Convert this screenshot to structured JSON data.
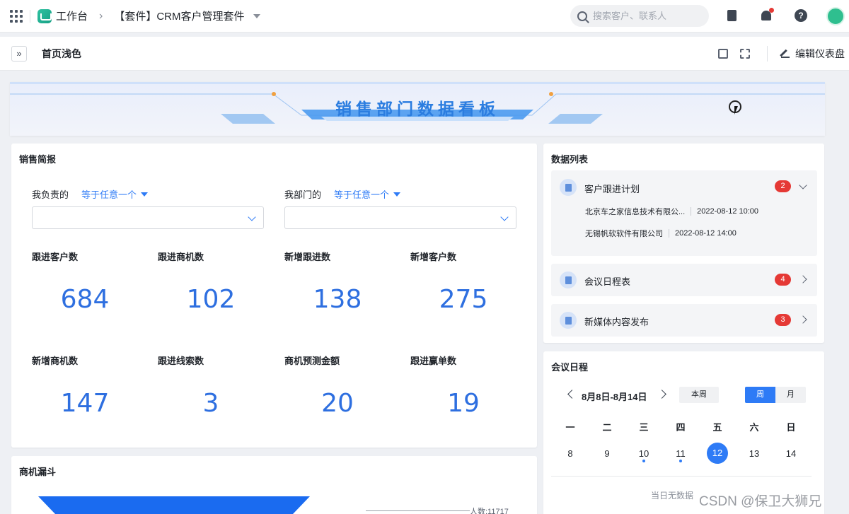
{
  "topbar": {
    "app_name": "工作台",
    "crumb_sep": "›",
    "suite_name": "【套件】CRM客户管理套件",
    "search_placeholder": "搜索客户、联系人",
    "help_label": "?"
  },
  "subbar": {
    "page_tab": "首页浅色",
    "expand_label": "»",
    "edit_label": "编辑仪表盘"
  },
  "banner": {
    "title": "销售部门数据看板"
  },
  "sales_brief": {
    "title": "销售简报",
    "filters": [
      {
        "label": "我负责的",
        "operator": "等于任意一个",
        "value": ""
      },
      {
        "label": "我部门的",
        "operator": "等于任意一个",
        "value": ""
      }
    ],
    "metrics": [
      {
        "label": "跟进客户数",
        "value": "684"
      },
      {
        "label": "跟进商机数",
        "value": "102"
      },
      {
        "label": "新增跟进数",
        "value": "138"
      },
      {
        "label": "新增客户数",
        "value": "275"
      },
      {
        "label": "新增商机数",
        "value": "147"
      },
      {
        "label": "跟进线索数",
        "value": "3"
      },
      {
        "label": "商机预测金额",
        "value": "20"
      },
      {
        "label": "跟进赢单数",
        "value": "19"
      }
    ]
  },
  "funnel": {
    "title": "商机漏斗",
    "label": "人数:11717",
    "color": "#1a6bf0"
  },
  "data_list": {
    "title": "数据列表",
    "items": [
      {
        "name": "客户跟进计划",
        "count": "2",
        "expanded": true,
        "rows": [
          {
            "company": "北京车之家信息技术有限公...",
            "time": "2022-08-12 10:00"
          },
          {
            "company": "无锡帆软软件有限公司",
            "time": "2022-08-12 14:00"
          }
        ]
      },
      {
        "name": "会议日程表",
        "count": "4",
        "expanded": false
      },
      {
        "name": "新媒体内容发布",
        "count": "3",
        "expanded": false
      }
    ]
  },
  "meeting": {
    "title": "会议日程",
    "range": "8月8日-8月14日",
    "this_week": "本周",
    "view_week": "周",
    "view_month": "月",
    "weekdays": [
      "一",
      "二",
      "三",
      "四",
      "五",
      "六",
      "日"
    ],
    "days": [
      "8",
      "9",
      "10",
      "11",
      "12",
      "13",
      "14"
    ],
    "today": "12",
    "days_with_events": [
      "10",
      "11"
    ],
    "no_data": "当日无数据"
  },
  "watermark": "CSDN @保卫大狮兄",
  "colors": {
    "accent": "#2e7bf6",
    "metric": "#2e6fe0",
    "badge": "#e53935",
    "banner_title": "#2b7de0"
  }
}
